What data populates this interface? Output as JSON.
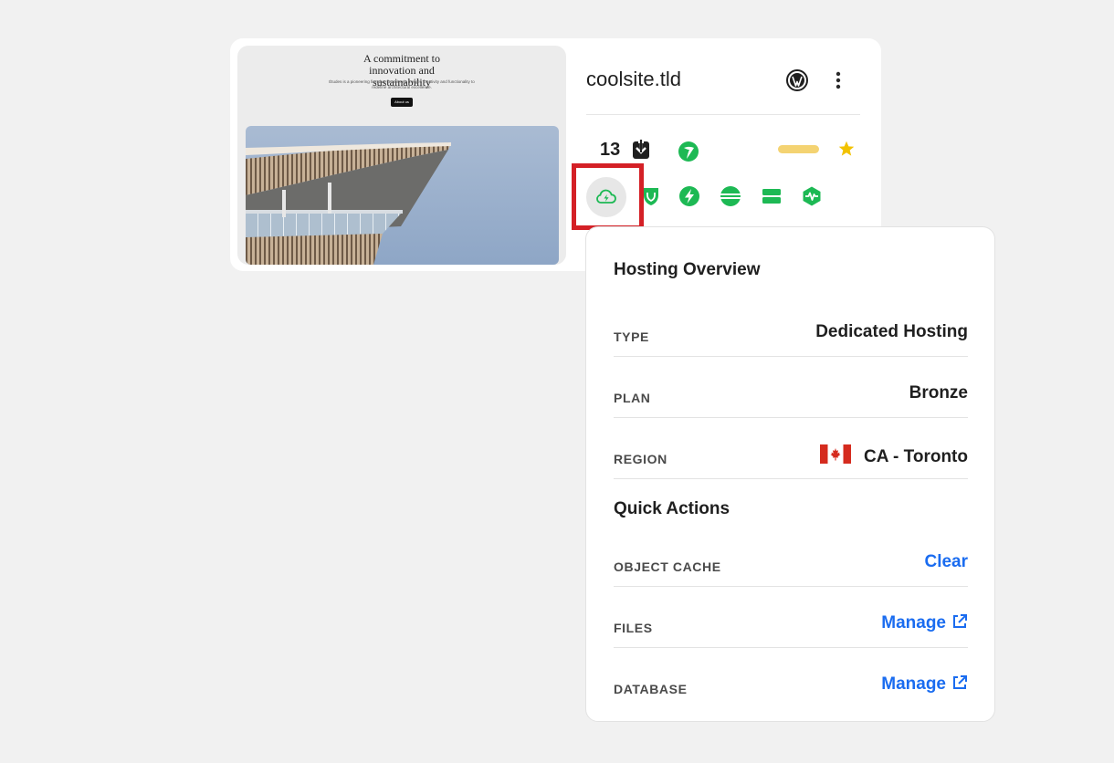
{
  "site": {
    "title": "coolsite.tld",
    "preview": {
      "heading": "A commitment to innovation and sustainability",
      "subtext": "Études is a pioneering firm that seamlessly merges creativity and functionality to redefine architectural excellence.",
      "button_label": "About us"
    },
    "stats": {
      "count": "13"
    },
    "icons": {
      "header": [
        "wordpress-icon",
        "more-vertical-icon"
      ],
      "row1": [
        "download-icon",
        "leaf-icon",
        "progress-pill",
        "star-icon"
      ],
      "row2": [
        "cloud-lightning-icon",
        "shield-icon",
        "bolt-icon",
        "cdn-icon",
        "server-icon",
        "activity-icon"
      ]
    }
  },
  "popover": {
    "hosting_title": "Hosting Overview",
    "hosting_rows": [
      {
        "label": "TYPE",
        "value": "Dedicated Hosting"
      },
      {
        "label": "PLAN",
        "value": "Bronze"
      },
      {
        "label": "REGION",
        "value": "CA - Toronto",
        "flag": "canada-flag-icon"
      }
    ],
    "actions_title": "Quick Actions",
    "action_rows": [
      {
        "label": "OBJECT CACHE",
        "action": "Clear"
      },
      {
        "label": "FILES",
        "action": "Manage"
      },
      {
        "label": "DATABASE",
        "action": "Manage"
      }
    ]
  },
  "colors": {
    "accent_green": "#1db954",
    "link_blue": "#1a6cf0",
    "highlight_red": "#d42026",
    "star_gold": "#f2c200",
    "pill_yellow": "#f4d372"
  }
}
